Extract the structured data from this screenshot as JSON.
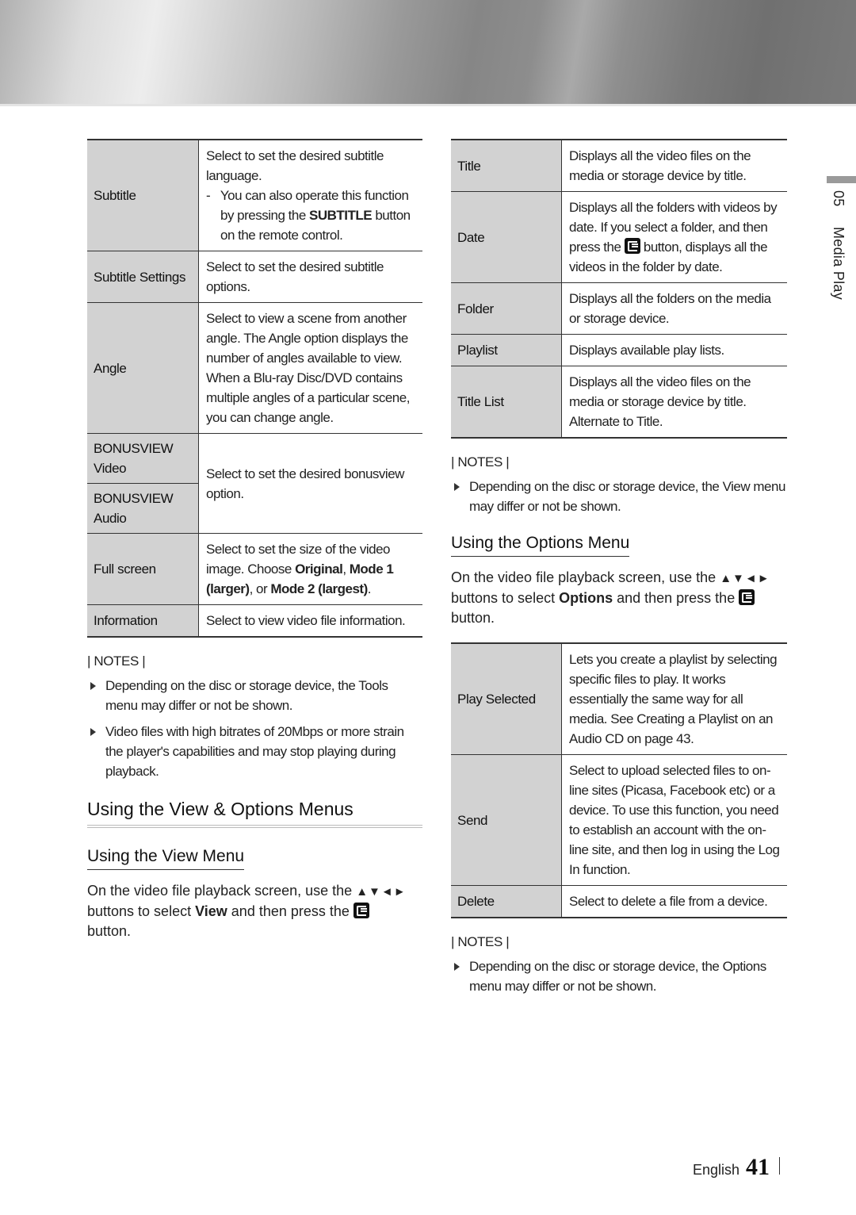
{
  "side_tab": {
    "chapter_number": "05",
    "chapter_title": "Media Play"
  },
  "left": {
    "table": [
      {
        "key": "Subtitle",
        "desc": "Select to set the desired subtitle language.",
        "sub_pre": "You can also operate this function by pressing the ",
        "sub_bold": "SUBTITLE",
        "sub_post": " button on the remote control."
      },
      {
        "key": "Subtitle Settings",
        "desc": "Select to set the desired subtitle options."
      },
      {
        "key": "Angle",
        "desc": "Select to view a scene from another angle. The Angle option displays the number of angles available to view. When a Blu-ray Disc/DVD contains multiple angles of a particular scene, you can change angle."
      },
      {
        "key": "BONUSVIEW Video",
        "desc": "Select to set the desired bonusview option."
      },
      {
        "key": "BONUSVIEW Audio"
      },
      {
        "key": "Full screen",
        "desc_pre": "Select to set the size of the video image. Choose ",
        "opt1": "Original",
        "sep1": ", ",
        "opt2": "Mode 1 (larger)",
        "sep2": ", or ",
        "opt3": "Mode 2 (largest)",
        "desc_post": "."
      },
      {
        "key": "Information",
        "desc": "Select to view video file information."
      }
    ],
    "notes_heading": "| NOTES |",
    "notes": [
      "Depending on the disc or storage device, the Tools menu may differ or not be shown.",
      "Video files with high bitrates of 20Mbps or more strain the player's capabilities and may stop playing during playback."
    ],
    "section_title": "Using the View & Options Menus",
    "subsection_title": "Using the View Menu",
    "para_pre": "On the video file playback screen, use the ",
    "arrows": "▲▼◄►",
    "para_mid": " buttons to select ",
    "para_bold": "View",
    "para_post": " and then press the ",
    "para_end": " button."
  },
  "right": {
    "view_table": [
      {
        "key": "Title",
        "desc": "Displays all the video files on the media or storage device by title."
      },
      {
        "key": "Date",
        "desc_pre": "Displays all the folders with videos by date. If you select a folder, and then press the ",
        "desc_post": " button, displays all the videos in the folder by date."
      },
      {
        "key": "Folder",
        "desc": "Displays all the folders on the media or storage device."
      },
      {
        "key": "Playlist",
        "desc": "Displays available play lists."
      },
      {
        "key": "Title List",
        "desc": "Displays all the video files on the media or storage device by title. Alternate to Title."
      }
    ],
    "notes_heading": "| NOTES |",
    "notes": [
      "Depending on the disc or storage device, the View menu may differ or not be shown."
    ],
    "subsection_title": "Using the Options Menu",
    "para_pre": "On the video file playback screen, use the ",
    "arrows": "▲▼◄►",
    "para_mid": " buttons to select ",
    "para_bold": "Options",
    "para_post": " and then press the ",
    "para_end": " button.",
    "options_table": [
      {
        "key": "Play Selected",
        "desc": "Lets you create a playlist by selecting specific files to play. It works essentially the same way for all media. See Creating a Playlist on an Audio CD on page 43."
      },
      {
        "key": "Send",
        "desc": "Select to upload selected files to on-line sites (Picasa, Facebook etc) or a device. To use this function, you need to establish an account with the on-line site, and then log in using the Log In function."
      },
      {
        "key": "Delete",
        "desc": "Select to delete a file from a device."
      }
    ],
    "notes2_heading": "| NOTES |",
    "notes2": [
      "Depending on the disc or storage device, the Options menu may differ or not be shown."
    ]
  },
  "footer": {
    "language": "English",
    "page_number": "41"
  }
}
